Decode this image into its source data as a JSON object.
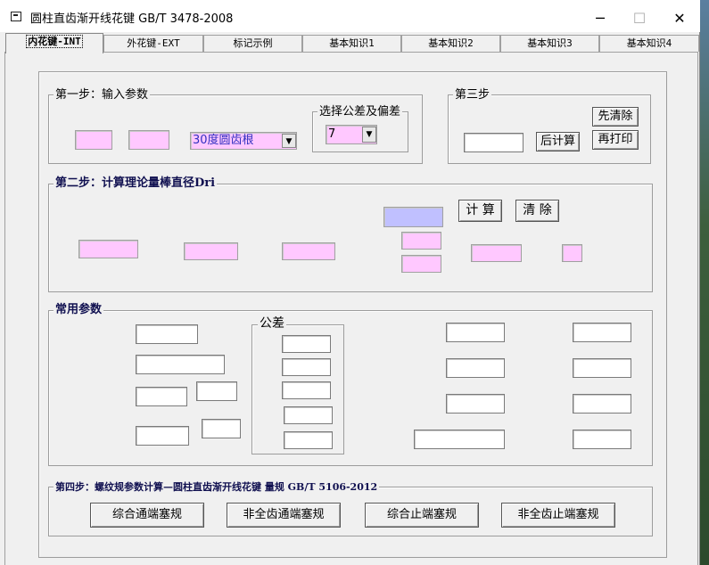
{
  "window": {
    "title": "圆柱直齿渐开线花键   GB/T 3478-2008",
    "minimize": "─",
    "maximize": "☐",
    "close": "✕"
  },
  "tabs": [
    {
      "label": "内花键-INT",
      "active": true
    },
    {
      "label": "外花键-EXT"
    },
    {
      "label": "标记示例"
    },
    {
      "label": "基本知识1"
    },
    {
      "label": "基本知识2"
    },
    {
      "label": "基本知识3"
    },
    {
      "label": "基本知识4"
    }
  ],
  "step1": {
    "title": "第一步：输入参数",
    "root_type_value": "30度圆齿根",
    "tolerance_group": {
      "title": "选择公差及偏差",
      "value": "7"
    }
  },
  "step3": {
    "title": "第三步",
    "clear_first_label": "先清除",
    "calculate_after_label": "后计算",
    "print_again_label": "再打印"
  },
  "step2": {
    "title": "第二步：计算理论量棒直径Dri",
    "calculate_label": "计 算",
    "clear_label": "清 除"
  },
  "common": {
    "title": "常用参数",
    "tolerance_title": "公差"
  },
  "step4": {
    "title": "第四步：螺纹规参数计算—圆柱直齿渐开线花键 量规  GB/T 5106-2012",
    "buttons": [
      "综合通端塞规",
      "非全齿通端塞规",
      "综合止端塞规",
      "非全齿止端塞规"
    ]
  },
  "colors": {
    "input_pink": "#ffc8ff",
    "input_blue": "#c0c0ff",
    "frame_title_bold": "#101050"
  }
}
